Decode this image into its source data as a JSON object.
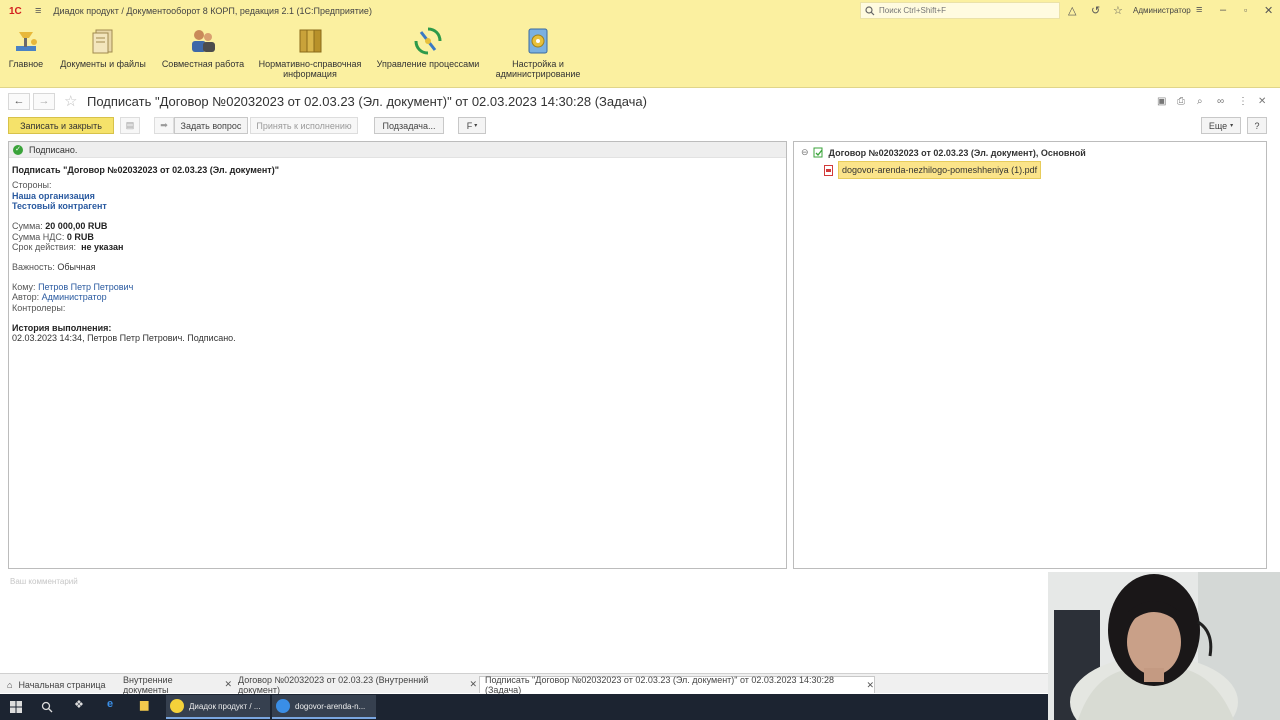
{
  "titlebar": {
    "logo": "1С",
    "menu_glyph": "≡",
    "title": "Диадок продукт / Документооборот 8 КОРП, редакция 2.1  (1С:Предприятие)",
    "search_placeholder": "Поиск Ctrl+Shift+F",
    "user": "Администратор"
  },
  "sections": [
    {
      "label": "Главное"
    },
    {
      "label": "Документы и файлы"
    },
    {
      "label": "Совместная работа"
    },
    {
      "label": "Нормативно-справочная информация"
    },
    {
      "label": "Управление процессами"
    },
    {
      "label": "Настройка и администрирование"
    }
  ],
  "form": {
    "title": "Подписать \"Договор №02032023 от 02.03.23 (Эл. документ)\" от 02.03.2023 14:30:28 (Задача)"
  },
  "toolbar": {
    "save_close": "Записать и закрыть",
    "ask": "Задать вопрос",
    "accept": "Принять к исполнению",
    "subtask": "Подзадача...",
    "flag": "F",
    "more": "Еще",
    "help": "?"
  },
  "left": {
    "status": "Подписано.",
    "heading": "Подписать \"Договор №02032023 от 02.03.23 (Эл. документ)\"",
    "parties_label": "Стороны:",
    "party1": "Наша организация",
    "party2": "Тестовый контрагент",
    "sum_label": "Сумма:",
    "sum_value": "20 000,00 RUB",
    "vat_label": "Сумма НДС:",
    "vat_value": "0 RUB",
    "term_label": "Срок действия:",
    "term_value": "не указан",
    "importance_label": "Важность:",
    "importance_value": "Обычная",
    "to_label": "Кому:",
    "to_value": "Петров Петр Петрович",
    "author_label": "Автор:",
    "author_value": "Администратор",
    "controllers_label": "Контролеры:",
    "history_label": "История выполнения:",
    "history_entry": "02.03.2023 14:34, Петров Петр Петрович. Подписано."
  },
  "right": {
    "tree_title": "Договор №02032023 от 02.03.23 (Эл. документ), Основной",
    "file": "dogovor-arenda-nezhilogo-pomeshheniya (1).pdf"
  },
  "comment": {
    "placeholder": "Ваш комментарий"
  },
  "windows": [
    {
      "label": "Начальная страница"
    },
    {
      "label": "Внутренние документы"
    },
    {
      "label": "Договор №02032023 от 02.03.23 (Внутренний документ)"
    },
    {
      "label": "Подписать \"Договор №02032023 от 02.03.23 (Эл. документ)\" от 02.03.2023 14:30:28 (Задача)"
    }
  ],
  "taskbar": {
    "app1": "Диадок продукт / ...",
    "app2": "dogovor-arenda-n..."
  },
  "colors": {
    "accent_yellow": "#fbf0a0",
    "primary_button": "#f5e26a",
    "link": "#2a5aa0",
    "status_green": "#3aa33a"
  }
}
